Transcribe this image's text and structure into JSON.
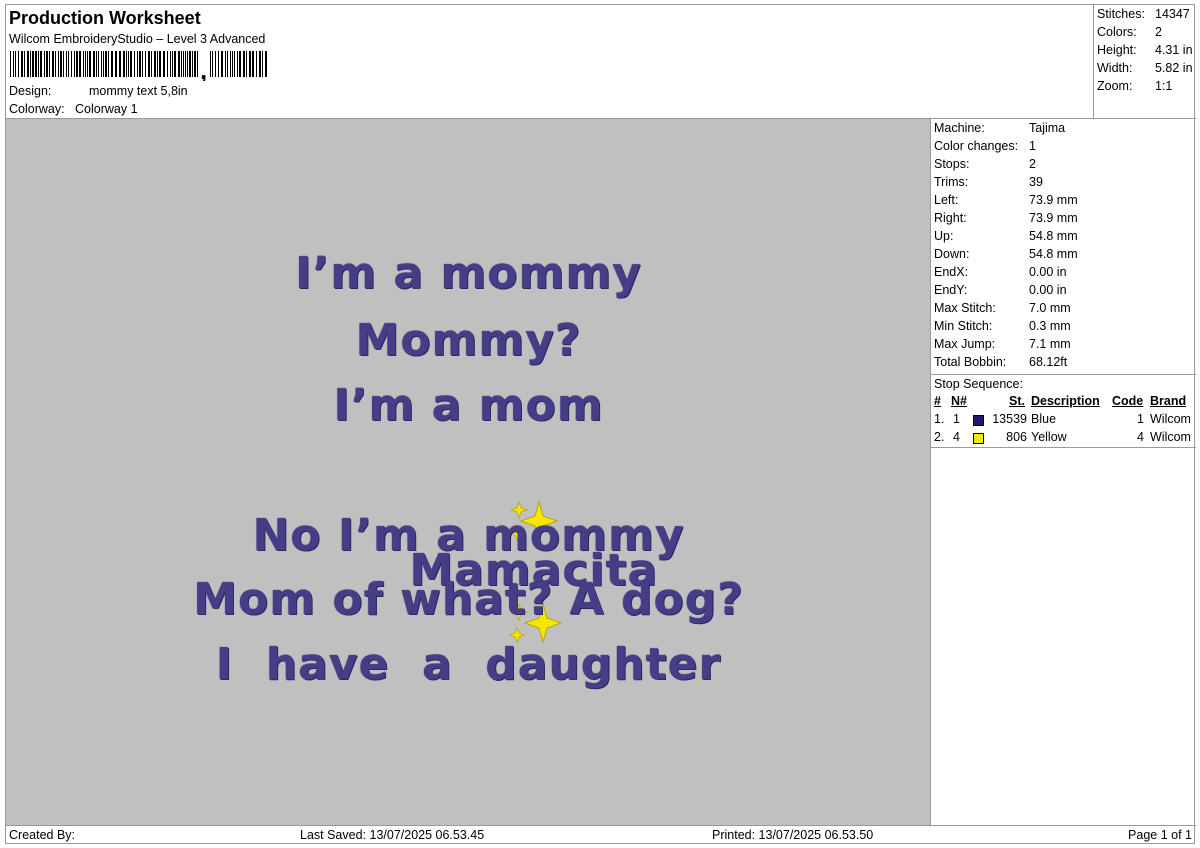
{
  "header": {
    "title": "Production Worksheet",
    "subtitle": "Wilcom EmbroideryStudio – Level 3 Advanced",
    "design_label": "Design:",
    "design_value": "mommy text 5,8in",
    "colorway_label": "Colorway:",
    "colorway_value": "Colorway 1"
  },
  "stats": [
    {
      "label": "Stitches:",
      "value": "14347"
    },
    {
      "label": "Colors:",
      "value": "2"
    },
    {
      "label": "Height:",
      "value": "4.31 in"
    },
    {
      "label": "Width:",
      "value": "5.82 in"
    },
    {
      "label": "Zoom:",
      "value": "1:1"
    }
  ],
  "design_lines": [
    "I’m a mommy",
    "Mommy?",
    "I’m a mom",
    "Mamacita",
    "No I’m a mommy",
    "Mom of what? A dog?",
    "I  have  a  daughter"
  ],
  "machine_info": [
    {
      "label": "Machine:",
      "value": "Tajima"
    },
    {
      "label": "Color changes:",
      "value": "1"
    },
    {
      "label": "Stops:",
      "value": "2"
    },
    {
      "label": "Trims:",
      "value": "39"
    },
    {
      "label": "Left:",
      "value": "73.9 mm"
    },
    {
      "label": "Right:",
      "value": "73.9 mm"
    },
    {
      "label": "Up:",
      "value": "54.8 mm"
    },
    {
      "label": "Down:",
      "value": "54.8 mm"
    },
    {
      "label": "EndX:",
      "value": "0.00 in"
    },
    {
      "label": "EndY:",
      "value": "0.00 in"
    },
    {
      "label": "Max Stitch:",
      "value": "7.0 mm"
    },
    {
      "label": "Min Stitch:",
      "value": "0.3 mm"
    },
    {
      "label": "Max Jump:",
      "value": "7.1 mm"
    },
    {
      "label": "Total Bobbin:",
      "value": "68.12ft"
    }
  ],
  "stop_sequence": {
    "title": "Stop Sequence:",
    "columns": [
      "#",
      "N#",
      "St.",
      "Description",
      "Code",
      "Brand"
    ],
    "rows": [
      {
        "num": "1.",
        "n": "1",
        "color": "#1f1a6e",
        "st": "13539",
        "desc": "Blue",
        "code": "1",
        "brand": "Wilcom"
      },
      {
        "num": "2.",
        "n": "4",
        "color": "#f5e800",
        "st": "806",
        "desc": "Yellow",
        "code": "4",
        "brand": "Wilcom"
      }
    ]
  },
  "footer": {
    "created_by": "Created By:",
    "last_saved": "Last Saved: 13/07/2025 06.53.45",
    "printed": "Printed: 13/07/2025 06.53.50",
    "page": "Page 1 of 1"
  },
  "colors": {
    "thread_blue": "#463d87",
    "thread_yellow": "#f5e800",
    "preview_bg": "#c0c0c0"
  }
}
